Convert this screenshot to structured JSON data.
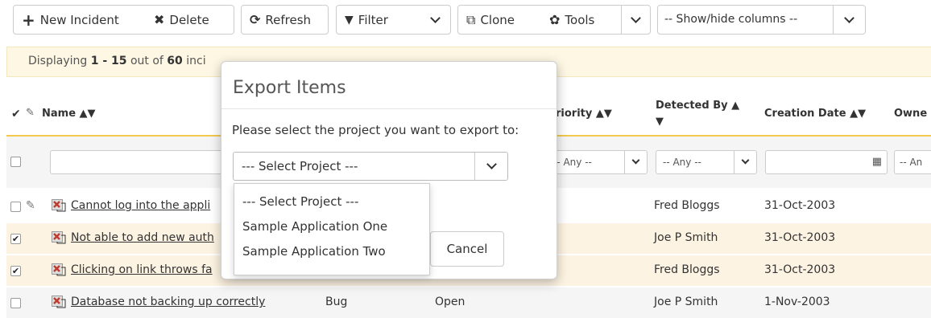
{
  "toolbar": {
    "new_incident": "New Incident",
    "delete": "Delete",
    "refresh": "Refresh",
    "filter": "Filter",
    "clone": "Clone",
    "tools": "Tools",
    "columns_select": "-- Show/hide columns --"
  },
  "info": {
    "prefix": "Displaying ",
    "range": "1 - 15",
    "mid": " out of ",
    "total": "60",
    "suffix": " inci"
  },
  "columns": {
    "name": "Name",
    "priority": "riority",
    "detected_by_1": "Detected By",
    "creation_date": "Creation Date",
    "owner": "Owne",
    "sort_asc": "▲",
    "sort_desc": "▼"
  },
  "filters": {
    "any_priority": "-- Any --",
    "any_detected": "-- Any --",
    "any_owner": "-- An"
  },
  "rows": [
    {
      "checked": false,
      "attach": true,
      "name": "Cannot log into the appli",
      "type": "",
      "status": "",
      "detected_by": "Fred Bloggs",
      "date": "31-Oct-2003"
    },
    {
      "checked": true,
      "attach": false,
      "name": "Not able to add new auth",
      "type": "",
      "status": "",
      "detected_by": "Joe P Smith",
      "date": "31-Oct-2003"
    },
    {
      "checked": true,
      "attach": false,
      "name": "Clicking on link throws fa",
      "type": "",
      "status": "",
      "detected_by": "Fred Bloggs",
      "date": "31-Oct-2003"
    },
    {
      "checked": false,
      "attach": false,
      "name": "Database not backing up correctly",
      "type": "Bug",
      "status": "Open",
      "detected_by": "Joe P Smith",
      "date": "1-Nov-2003"
    }
  ],
  "modal": {
    "title": "Export Items",
    "message": "Please select the project you want to export to:",
    "selected": "--- Select Project ---",
    "options": [
      "--- Select Project ---",
      "Sample Application One",
      "Sample Application Two"
    ],
    "cancel": "Cancel"
  },
  "colors": {
    "accent": "#f2c94c",
    "info_bg": "#fdf7e3",
    "alt_row": "#fdf3e2"
  }
}
